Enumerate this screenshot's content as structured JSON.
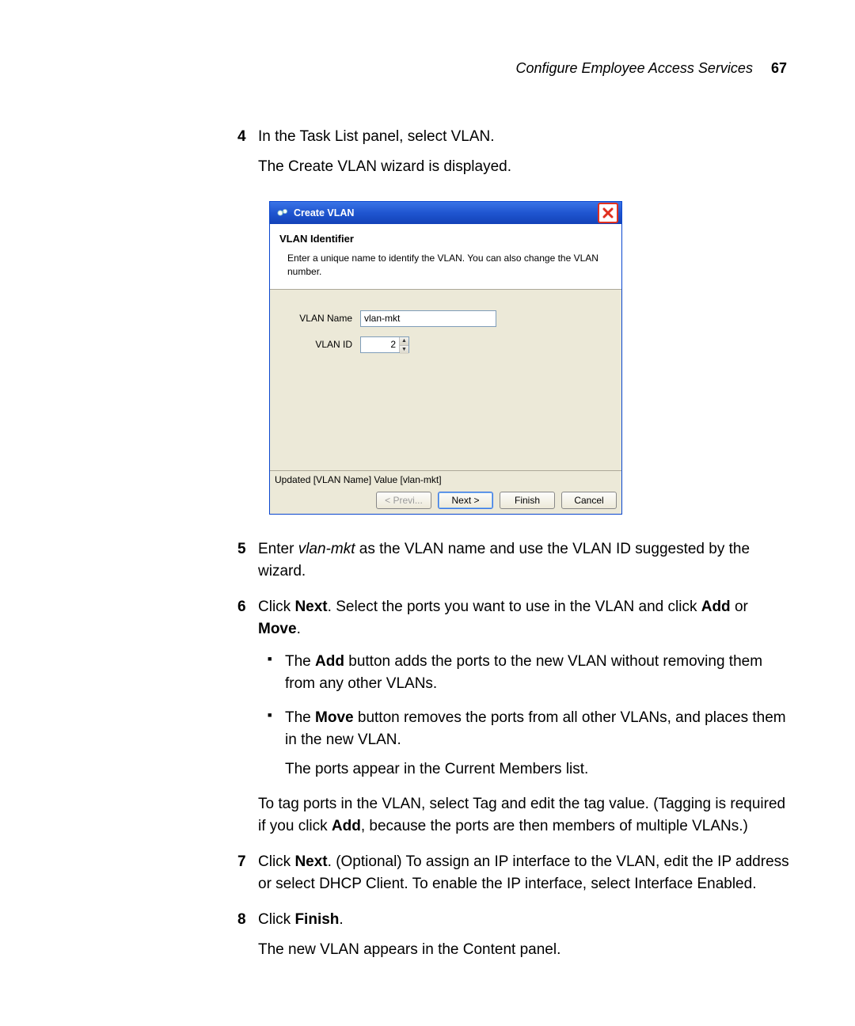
{
  "header": {
    "section": "Configure Employee Access Services",
    "page_number": "67"
  },
  "steps": {
    "s4": {
      "line1": "In the Task List panel, select VLAN.",
      "line2": "The Create VLAN wizard is displayed."
    },
    "s5": {
      "prefix": "Enter ",
      "italic": "vlan-mkt",
      "suffix": " as the VLAN name and use the VLAN ID suggested by the wizard."
    },
    "s6": {
      "p1a": "Click ",
      "p1b_bold": "Next",
      "p1c": ". Select the ports you want to use in the VLAN and click ",
      "p1d_bold": "Add",
      "p1e": " or ",
      "p1f_bold": "Move",
      "p1g": ".",
      "bullet1a": "The ",
      "bullet1b_bold": "Add",
      "bullet1c": " button adds the ports to the new VLAN without removing them from any other VLANs.",
      "bullet2a": "The ",
      "bullet2b_bold": "Move",
      "bullet2c": " button removes the ports from all other VLANs, and places them in the new VLAN.",
      "bullet_after": "The ports appear in the Current Members list.",
      "tag1": "To tag ports in the VLAN, select Tag and edit the tag value. (Tagging is required if you click ",
      "tag2_bold": "Add",
      "tag3": ", because the ports are then members of multiple VLANs.)"
    },
    "s7": {
      "a": "Click ",
      "b_bold": "Next",
      "c": ". (Optional) To assign an IP interface to the VLAN, edit the IP address or select DHCP Client. To enable the IP interface, select Interface Enabled."
    },
    "s8": {
      "a": "Click ",
      "b_bold": "Finish",
      "c": ".",
      "after": "The new VLAN appears in the Content panel."
    }
  },
  "dialog": {
    "title": "Create VLAN",
    "section_title": "VLAN Identifier",
    "section_subtitle": "Enter a unique name to identify the VLAN. You can also change the VLAN number.",
    "label_name": "VLAN Name",
    "value_name": "vlan-mkt",
    "label_id": "VLAN ID",
    "value_id": "2",
    "status": "Updated [VLAN Name] Value [vlan-mkt]",
    "buttons": {
      "prev": "< Previ...",
      "next": "Next >",
      "finish": "Finish",
      "cancel": "Cancel"
    }
  }
}
